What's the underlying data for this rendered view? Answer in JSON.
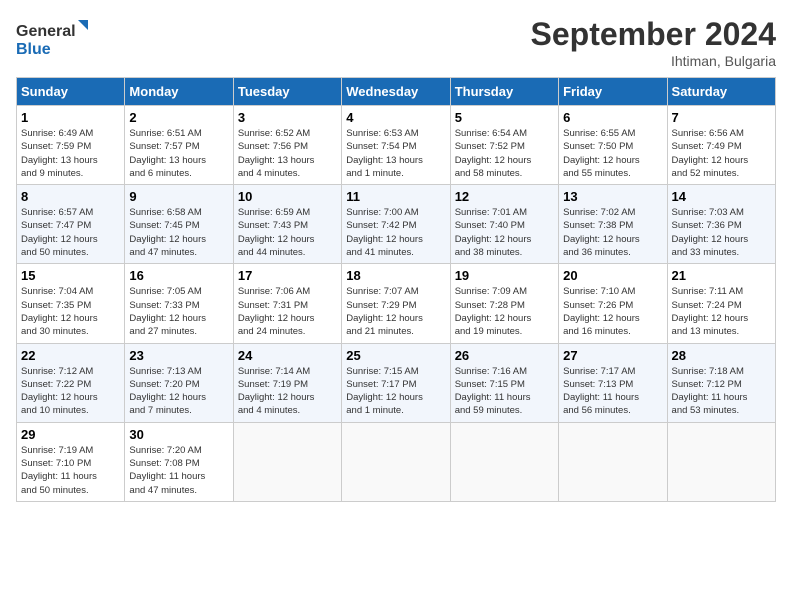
{
  "header": {
    "logo_general": "General",
    "logo_blue": "Blue",
    "month_year": "September 2024",
    "location": "Ihtiman, Bulgaria"
  },
  "columns": [
    "Sunday",
    "Monday",
    "Tuesday",
    "Wednesday",
    "Thursday",
    "Friday",
    "Saturday"
  ],
  "weeks": [
    [
      {
        "day": "1",
        "detail": "Sunrise: 6:49 AM\nSunset: 7:59 PM\nDaylight: 13 hours\nand 9 minutes."
      },
      {
        "day": "2",
        "detail": "Sunrise: 6:51 AM\nSunset: 7:57 PM\nDaylight: 13 hours\nand 6 minutes."
      },
      {
        "day": "3",
        "detail": "Sunrise: 6:52 AM\nSunset: 7:56 PM\nDaylight: 13 hours\nand 4 minutes."
      },
      {
        "day": "4",
        "detail": "Sunrise: 6:53 AM\nSunset: 7:54 PM\nDaylight: 13 hours\nand 1 minute."
      },
      {
        "day": "5",
        "detail": "Sunrise: 6:54 AM\nSunset: 7:52 PM\nDaylight: 12 hours\nand 58 minutes."
      },
      {
        "day": "6",
        "detail": "Sunrise: 6:55 AM\nSunset: 7:50 PM\nDaylight: 12 hours\nand 55 minutes."
      },
      {
        "day": "7",
        "detail": "Sunrise: 6:56 AM\nSunset: 7:49 PM\nDaylight: 12 hours\nand 52 minutes."
      }
    ],
    [
      {
        "day": "8",
        "detail": "Sunrise: 6:57 AM\nSunset: 7:47 PM\nDaylight: 12 hours\nand 50 minutes."
      },
      {
        "day": "9",
        "detail": "Sunrise: 6:58 AM\nSunset: 7:45 PM\nDaylight: 12 hours\nand 47 minutes."
      },
      {
        "day": "10",
        "detail": "Sunrise: 6:59 AM\nSunset: 7:43 PM\nDaylight: 12 hours\nand 44 minutes."
      },
      {
        "day": "11",
        "detail": "Sunrise: 7:00 AM\nSunset: 7:42 PM\nDaylight: 12 hours\nand 41 minutes."
      },
      {
        "day": "12",
        "detail": "Sunrise: 7:01 AM\nSunset: 7:40 PM\nDaylight: 12 hours\nand 38 minutes."
      },
      {
        "day": "13",
        "detail": "Sunrise: 7:02 AM\nSunset: 7:38 PM\nDaylight: 12 hours\nand 36 minutes."
      },
      {
        "day": "14",
        "detail": "Sunrise: 7:03 AM\nSunset: 7:36 PM\nDaylight: 12 hours\nand 33 minutes."
      }
    ],
    [
      {
        "day": "15",
        "detail": "Sunrise: 7:04 AM\nSunset: 7:35 PM\nDaylight: 12 hours\nand 30 minutes."
      },
      {
        "day": "16",
        "detail": "Sunrise: 7:05 AM\nSunset: 7:33 PM\nDaylight: 12 hours\nand 27 minutes."
      },
      {
        "day": "17",
        "detail": "Sunrise: 7:06 AM\nSunset: 7:31 PM\nDaylight: 12 hours\nand 24 minutes."
      },
      {
        "day": "18",
        "detail": "Sunrise: 7:07 AM\nSunset: 7:29 PM\nDaylight: 12 hours\nand 21 minutes."
      },
      {
        "day": "19",
        "detail": "Sunrise: 7:09 AM\nSunset: 7:28 PM\nDaylight: 12 hours\nand 19 minutes."
      },
      {
        "day": "20",
        "detail": "Sunrise: 7:10 AM\nSunset: 7:26 PM\nDaylight: 12 hours\nand 16 minutes."
      },
      {
        "day": "21",
        "detail": "Sunrise: 7:11 AM\nSunset: 7:24 PM\nDaylight: 12 hours\nand 13 minutes."
      }
    ],
    [
      {
        "day": "22",
        "detail": "Sunrise: 7:12 AM\nSunset: 7:22 PM\nDaylight: 12 hours\nand 10 minutes."
      },
      {
        "day": "23",
        "detail": "Sunrise: 7:13 AM\nSunset: 7:20 PM\nDaylight: 12 hours\nand 7 minutes."
      },
      {
        "day": "24",
        "detail": "Sunrise: 7:14 AM\nSunset: 7:19 PM\nDaylight: 12 hours\nand 4 minutes."
      },
      {
        "day": "25",
        "detail": "Sunrise: 7:15 AM\nSunset: 7:17 PM\nDaylight: 12 hours\nand 1 minute."
      },
      {
        "day": "26",
        "detail": "Sunrise: 7:16 AM\nSunset: 7:15 PM\nDaylight: 11 hours\nand 59 minutes."
      },
      {
        "day": "27",
        "detail": "Sunrise: 7:17 AM\nSunset: 7:13 PM\nDaylight: 11 hours\nand 56 minutes."
      },
      {
        "day": "28",
        "detail": "Sunrise: 7:18 AM\nSunset: 7:12 PM\nDaylight: 11 hours\nand 53 minutes."
      }
    ],
    [
      {
        "day": "29",
        "detail": "Sunrise: 7:19 AM\nSunset: 7:10 PM\nDaylight: 11 hours\nand 50 minutes."
      },
      {
        "day": "30",
        "detail": "Sunrise: 7:20 AM\nSunset: 7:08 PM\nDaylight: 11 hours\nand 47 minutes."
      },
      {
        "day": "",
        "detail": ""
      },
      {
        "day": "",
        "detail": ""
      },
      {
        "day": "",
        "detail": ""
      },
      {
        "day": "",
        "detail": ""
      },
      {
        "day": "",
        "detail": ""
      }
    ]
  ]
}
